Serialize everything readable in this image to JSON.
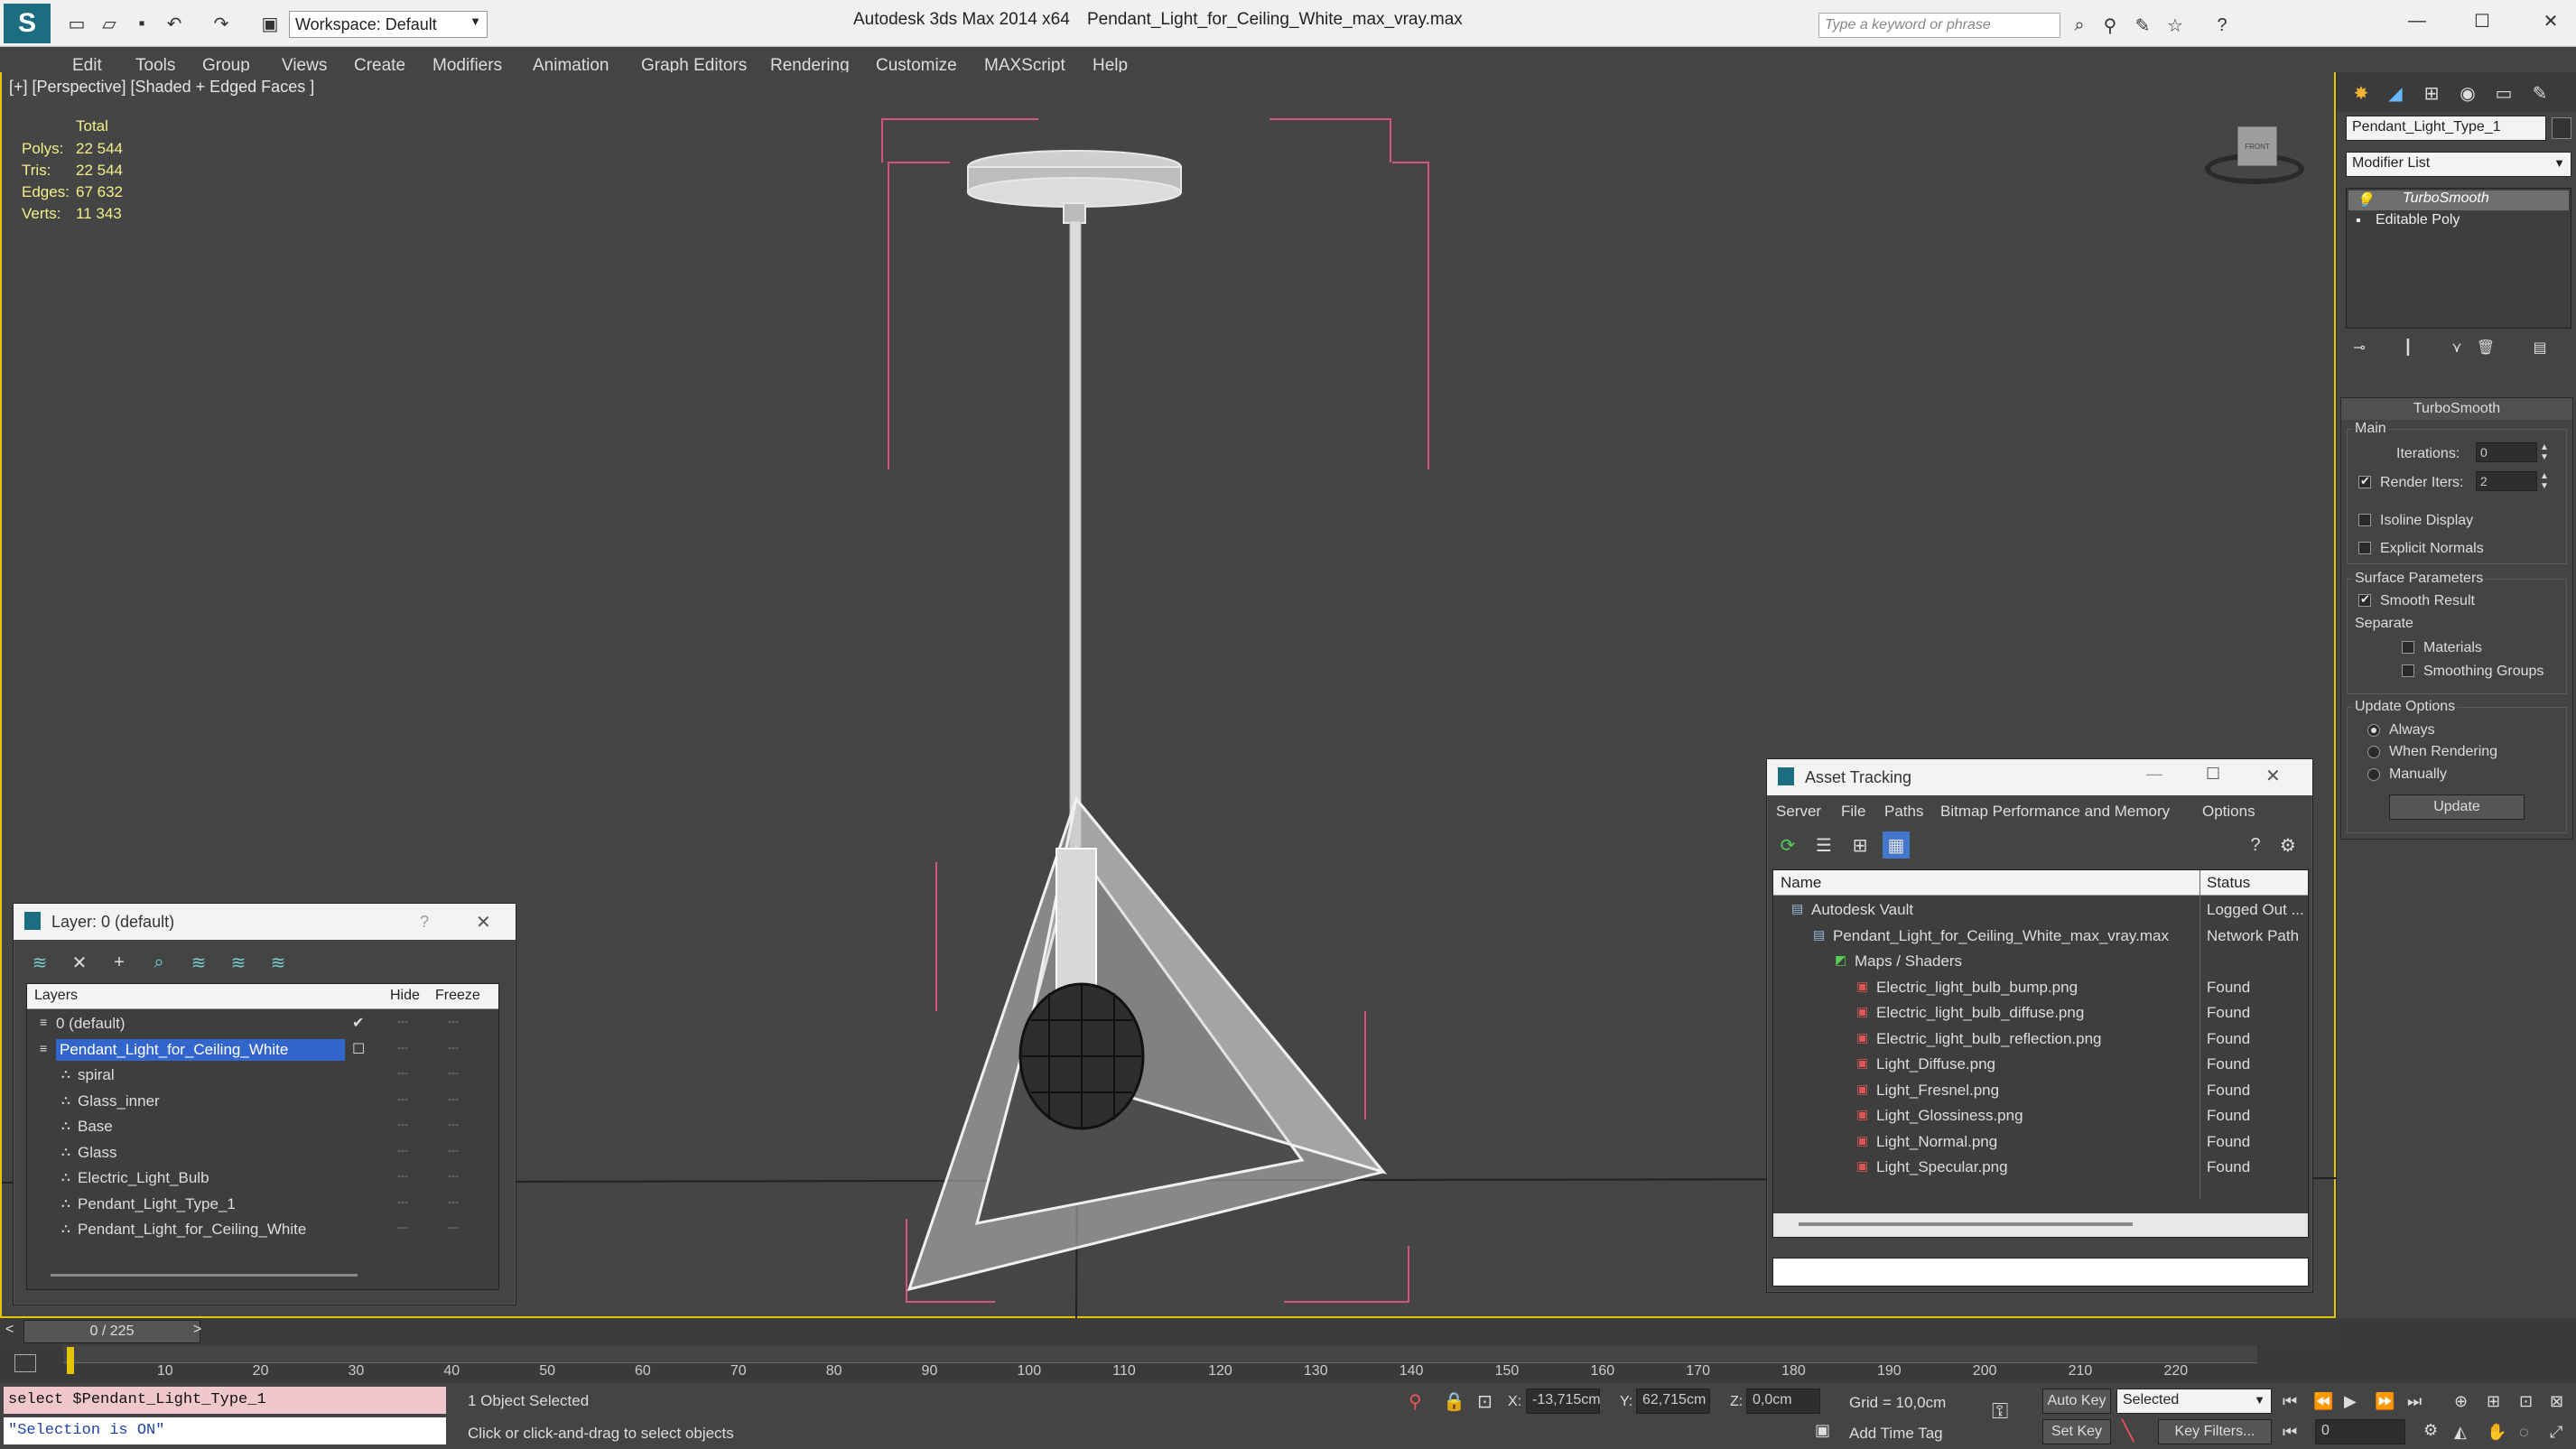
{
  "titlebar": {
    "app_title": "Autodesk 3ds Max  2014 x64",
    "file_title": "Pendant_Light_for_Ceiling_White_max_vray.max",
    "workspace": "Workspace: Default",
    "search_placeholder": "Type a keyword or phrase"
  },
  "menu": [
    "Edit",
    "Tools",
    "Group",
    "Views",
    "Create",
    "Modifiers",
    "Animation",
    "Graph Editors",
    "Rendering",
    "Customize",
    "MAXScript",
    "Help"
  ],
  "viewport": {
    "label": "[+] [Perspective] [Shaded + Edged Faces ]",
    "stats_header": "Total",
    "stats": [
      {
        "label": "Polys:",
        "value": "22 544"
      },
      {
        "label": "Tris:",
        "value": "22 544"
      },
      {
        "label": "Edges:",
        "value": "67 632"
      },
      {
        "label": "Verts:",
        "value": "11 343"
      }
    ],
    "viewcube_label": "FRONT"
  },
  "command_panel": {
    "object_name": "Pendant_Light_Type_1",
    "modifier_list": "Modifier List",
    "stack": [
      "TurboSmooth",
      "Editable Poly"
    ],
    "rollout_title": "TurboSmooth",
    "main_label": "Main",
    "iterations_label": "Iterations:",
    "iterations_value": "0",
    "render_iters_label": "Render Iters:",
    "render_iters_value": "2",
    "isoline": "Isoline Display",
    "explicit_normals": "Explicit Normals",
    "surface_params": "Surface Parameters",
    "smooth_result": "Smooth Result",
    "separate": "Separate",
    "materials": "Materials",
    "smoothing_groups": "Smoothing Groups",
    "update_options": "Update Options",
    "always": "Always",
    "when_rendering": "When Rendering",
    "manually": "Manually",
    "update_button": "Update"
  },
  "layer_window": {
    "title": "Layer: 0 (default)",
    "help": "?",
    "col_layers": "Layers",
    "col_hide": "Hide",
    "col_freeze": "Freeze",
    "rows": [
      {
        "name": "0 (default)",
        "indent": 0,
        "selected": false,
        "checked": true
      },
      {
        "name": "Pendant_Light_for_Ceiling_White",
        "indent": 0,
        "selected": true,
        "checked": false
      },
      {
        "name": "spiral",
        "indent": 1,
        "selected": false,
        "checked": false
      },
      {
        "name": "Glass_inner",
        "indent": 1,
        "selected": false,
        "checked": false
      },
      {
        "name": "Base",
        "indent": 1,
        "selected": false,
        "checked": false
      },
      {
        "name": "Glass",
        "indent": 1,
        "selected": false,
        "checked": false
      },
      {
        "name": "Electric_Light_Bulb",
        "indent": 1,
        "selected": false,
        "checked": false
      },
      {
        "name": "Pendant_Light_Type_1",
        "indent": 1,
        "selected": false,
        "checked": false
      },
      {
        "name": "Pendant_Light_for_Ceiling_White",
        "indent": 1,
        "selected": false,
        "checked": false
      }
    ]
  },
  "asset_window": {
    "title": "Asset Tracking",
    "menu": [
      "Server",
      "File",
      "Paths",
      "Bitmap Performance and Memory",
      "Options"
    ],
    "col_name": "Name",
    "col_status": "Status",
    "rows": [
      {
        "name": "Autodesk Vault",
        "status": "Logged Out ...",
        "indent": 0
      },
      {
        "name": "Pendant_Light_for_Ceiling_White_max_vray.max",
        "status": "Network Path",
        "indent": 1
      },
      {
        "name": "Maps / Shaders",
        "status": "",
        "indent": 2
      },
      {
        "name": "Electric_light_bulb_bump.png",
        "status": "Found",
        "indent": 3
      },
      {
        "name": "Electric_light_bulb_diffuse.png",
        "status": "Found",
        "indent": 3
      },
      {
        "name": "Electric_light_bulb_reflection.png",
        "status": "Found",
        "indent": 3
      },
      {
        "name": "Light_Diffuse.png",
        "status": "Found",
        "indent": 3
      },
      {
        "name": "Light_Fresnel.png",
        "status": "Found",
        "indent": 3
      },
      {
        "name": "Light_Glossiness.png",
        "status": "Found",
        "indent": 3
      },
      {
        "name": "Light_Normal.png",
        "status": "Found",
        "indent": 3
      },
      {
        "name": "Light_Specular.png",
        "status": "Found",
        "indent": 3
      }
    ]
  },
  "timeline": {
    "frame": "0 / 225",
    "ticks": [
      "10",
      "20",
      "30",
      "40",
      "50",
      "60",
      "70",
      "80",
      "90",
      "100",
      "110",
      "120",
      "130",
      "140",
      "150",
      "160",
      "170",
      "180",
      "190",
      "200",
      "210",
      "220"
    ]
  },
  "statusbar": {
    "script_line": "select $Pendant_Light_Type_1",
    "script_result": "\"Selection is ON\"",
    "selection": "1 Object Selected",
    "prompt": "Click or click-and-drag to select objects",
    "x_label": "X:",
    "x_value": "-13,715cm",
    "y_label": "Y:",
    "y_value": "62,715cm",
    "z_label": "Z:",
    "z_value": "0,0cm",
    "grid": "Grid = 10,0cm",
    "auto_key": "Auto Key",
    "set_key": "Set Key",
    "selected": "Selected",
    "key_filters": "Key Filters...",
    "add_time_tag": "Add Time Tag",
    "frame_field": "0"
  },
  "colors": {
    "accent": "#e5c400",
    "selection_blue": "#3366cc",
    "bbox_pink": "#d2557a",
    "stats_yellow": "#f2f08a"
  }
}
